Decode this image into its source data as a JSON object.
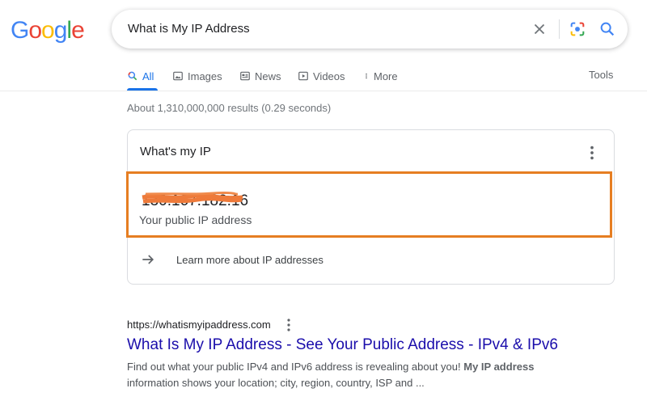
{
  "logo": {
    "letters": [
      "G",
      "o",
      "o",
      "g",
      "l",
      "e"
    ],
    "colors": [
      "#4285F4",
      "#EA4335",
      "#FBBC05",
      "#4285F4",
      "#34A853",
      "#EA4335"
    ]
  },
  "search": {
    "query": "What is My IP Address"
  },
  "tabs": {
    "all": "All",
    "images": "Images",
    "news": "News",
    "videos": "Videos",
    "more": "More",
    "tools": "Tools"
  },
  "results_count": "About 1,310,000,000 results (0.29 seconds)",
  "ip_card": {
    "title": "What's my IP",
    "ip_value": "130.167.182.16",
    "ip_label": "Your public IP address",
    "learn_more": "Learn more about IP addresses"
  },
  "result": {
    "url": "https://whatismyipaddress.com",
    "title": "What Is My IP Address - See Your Public Address - IPv4 & IPv6",
    "snippet_part1": "Find out what your public IPv4 and IPv6 address is revealing about you! ",
    "snippet_bold": "My IP address",
    "snippet_part2": "information shows your location; city, region, country, ISP and ..."
  },
  "colors": {
    "accent": "#1a73e8",
    "link": "#1a0dab",
    "highlight": "#e67e22"
  }
}
